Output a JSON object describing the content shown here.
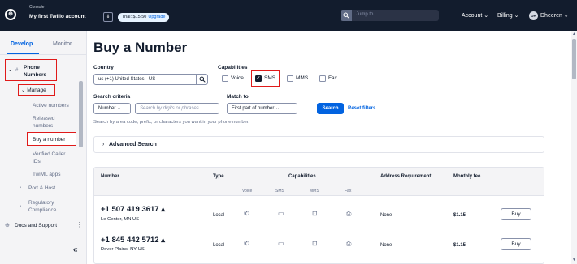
{
  "topbar": {
    "logo_glyph": "⊕",
    "console_label": "Console",
    "account_name": "My first Twilio account",
    "switch_glyph": "⇕",
    "trial_text": "Trial: $15.50",
    "upgrade_text": "Upgrade",
    "search_placeholder": "Jump to...",
    "search_icon": "search-icon",
    "account_menu": "Account ⌄",
    "billing_menu": "Billing ⌄",
    "avatar_initials": "DH",
    "user_menu": "Dheeren ⌄"
  },
  "sidebar": {
    "tabs": [
      "Develop",
      "Monitor"
    ],
    "phone_numbers": "Phone Numbers",
    "phone_toggle": "⌄",
    "manage": "⌄ Manage",
    "items": [
      "Active numbers",
      "Released numbers",
      "Buy a number",
      "Verified Caller IDs",
      "TwiML apps"
    ],
    "port_host": "Port & Host",
    "regulatory": "Regulatory Compliance",
    "docs_support": "Docs and Support",
    "collapse": "«",
    "highlight_color": "#e01a1a"
  },
  "main": {
    "title": "Buy a Number",
    "country_label": "Country",
    "country_value": "us (+1) United States - US",
    "capabilities_label": "Capabilities",
    "capabilities": [
      {
        "label": "Voice",
        "checked": false
      },
      {
        "label": "SMS",
        "checked": true
      },
      {
        "label": "MMS",
        "checked": false
      },
      {
        "label": "Fax",
        "checked": false
      }
    ],
    "search_criteria_label": "Search criteria",
    "search_criteria_value": "Number ⌄",
    "search_placeholder": "Search by digits or phrases",
    "match_to_label": "Match to",
    "match_to_value": "First part of number ⌄",
    "search_button": "Search",
    "reset_link": "Reset filters",
    "help_text": "Search by area code, prefix, or characters you want in your phone number.",
    "advanced_search": "Advanced Search",
    "advanced_chevron": "›",
    "table": {
      "headers": {
        "number": "Number",
        "type": "Type",
        "capabilities": "Capabilities",
        "address": "Address Requirement",
        "fee": "Monthly fee"
      },
      "cap_headers": [
        "Voice",
        "SMS",
        "MMS",
        "Fax"
      ],
      "cap_icons": [
        "✆",
        "▭",
        "⊡",
        "⎙"
      ],
      "rows": [
        {
          "number": "+1 507 419 3617 ▴",
          "location": "Le Center, MN US",
          "type": "Local",
          "address": "None",
          "fee": "$1.15",
          "action": "Buy"
        },
        {
          "number": "+1 845 442 5712 ▴",
          "location": "Dover Plains, NY US",
          "type": "Local",
          "address": "None",
          "fee": "$1.15",
          "action": "Buy"
        }
      ]
    }
  },
  "colors": {
    "topbar": "#121c2d",
    "primary": "#0263e0",
    "highlight": "#e01a1a"
  }
}
